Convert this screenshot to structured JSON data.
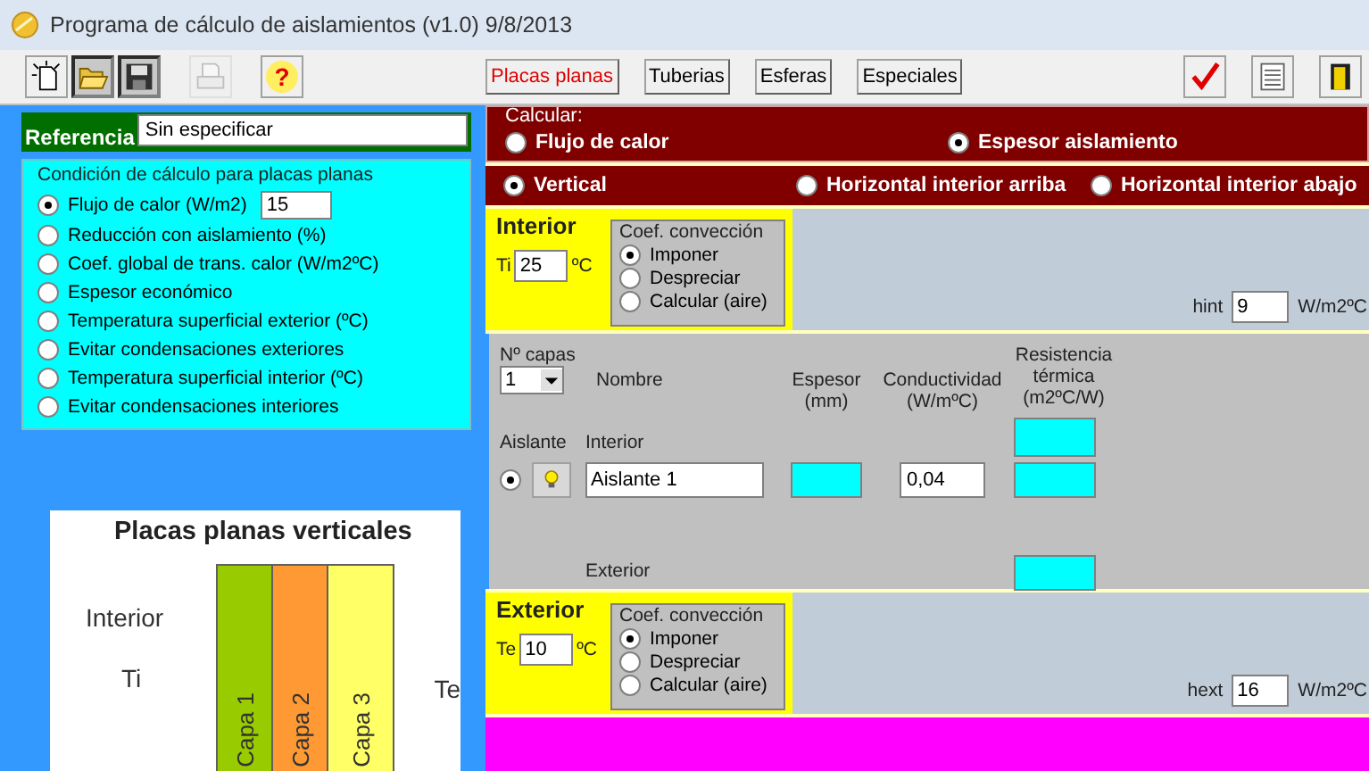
{
  "window": {
    "title": "Programa de cálculo de aislamientos (v1.0) 9/8/2013"
  },
  "toolbar": {
    "icon_buttons": [
      {
        "kind": "new",
        "pressed": false,
        "disabled": false
      },
      {
        "kind": "open",
        "pressed": true,
        "disabled": false
      },
      {
        "kind": "save",
        "pressed": true,
        "disabled": false
      },
      {
        "kind": "print",
        "pressed": false,
        "disabled": true
      },
      {
        "kind": "help",
        "pressed": false,
        "disabled": false,
        "label": "?"
      }
    ],
    "tabs": [
      {
        "label": "Placas planas",
        "selected": true
      },
      {
        "label": "Tuberias",
        "selected": false
      },
      {
        "label": "Esferas",
        "selected": false
      },
      {
        "label": "Especiales",
        "selected": false
      }
    ],
    "right_buttons": [
      {
        "kind": "check"
      },
      {
        "kind": "list"
      },
      {
        "kind": "exit"
      }
    ]
  },
  "reference": {
    "label": "Referencia",
    "value": "Sin especificar"
  },
  "condition": {
    "title": "Condición de cálculo para placas planas",
    "options": [
      {
        "label": "Flujo de calor  (W/m2)",
        "selected": true,
        "value": "15"
      },
      {
        "label": "Reducción con aislamiento (%)",
        "selected": false
      },
      {
        "label": "Coef. global de trans. calor (W/m2ºC)",
        "selected": false
      },
      {
        "label": "Espesor económico",
        "selected": false
      },
      {
        "label": "Temperatura superficial exterior (ºC)",
        "selected": false
      },
      {
        "label": "Evitar condensaciones exteriores",
        "selected": false
      },
      {
        "label": "Temperatura superficial interior (ºC)",
        "selected": false
      },
      {
        "label": "Evitar condensaciones interiores",
        "selected": false
      }
    ]
  },
  "diagram": {
    "title": "Placas planas verticales",
    "side_label": "Interior",
    "left_temp": "Ti",
    "right_temp": "Te",
    "layers": [
      {
        "label": "Capa 1",
        "color": "#99cc00"
      },
      {
        "label": "Capa 2",
        "color": "#ff9933"
      },
      {
        "label": "Capa 3",
        "color": "#ffff66"
      }
    ]
  },
  "calculate": {
    "title": "Calcular:",
    "options": [
      {
        "label": "Flujo de calor",
        "selected": false
      },
      {
        "label": "Espesor aislamiento",
        "selected": true
      }
    ]
  },
  "orientation": {
    "options": [
      {
        "label": "Vertical",
        "selected": true
      },
      {
        "label": "Horizontal interior arriba",
        "selected": false
      },
      {
        "label": "Horizontal interior abajo",
        "selected": false
      }
    ]
  },
  "interior": {
    "title": "Interior",
    "temp_label": "Ti",
    "temp_value": "25",
    "temp_unit": "ºC",
    "coef_title": "Coef. convección",
    "coef_options": [
      {
        "label": "Imponer",
        "selected": true
      },
      {
        "label": "Despreciar",
        "selected": false
      },
      {
        "label": "Calcular (aire)",
        "selected": false
      }
    ],
    "h_label": "hint",
    "h_value": "9",
    "h_unit": "W/m2ºC"
  },
  "layers_table": {
    "count_label": "Nº capas",
    "count_value": "1",
    "name_header": "Nombre",
    "thickness_header": "Espesor\n(mm)",
    "conductivity_header": "Conductividad\n(W/mºC)",
    "resistance_header": "Resistencia\ntérmica\n(m2ºC/W)",
    "insulation_label": "Aislante",
    "interior_label": "Interior",
    "exterior_label": "Exterior",
    "rows": [
      {
        "selected": true,
        "name": "Aislante 1",
        "conductivity": "0,04"
      }
    ]
  },
  "exterior": {
    "title": "Exterior",
    "temp_label": "Te",
    "temp_value": "10",
    "temp_unit": "ºC",
    "coef_title": "Coef. convección",
    "coef_options": [
      {
        "label": "Imponer",
        "selected": true
      },
      {
        "label": "Despreciar",
        "selected": false
      },
      {
        "label": "Calcular (aire)",
        "selected": false
      }
    ],
    "h_label": "hext",
    "h_value": "16",
    "h_unit": "W/m2ºC"
  }
}
